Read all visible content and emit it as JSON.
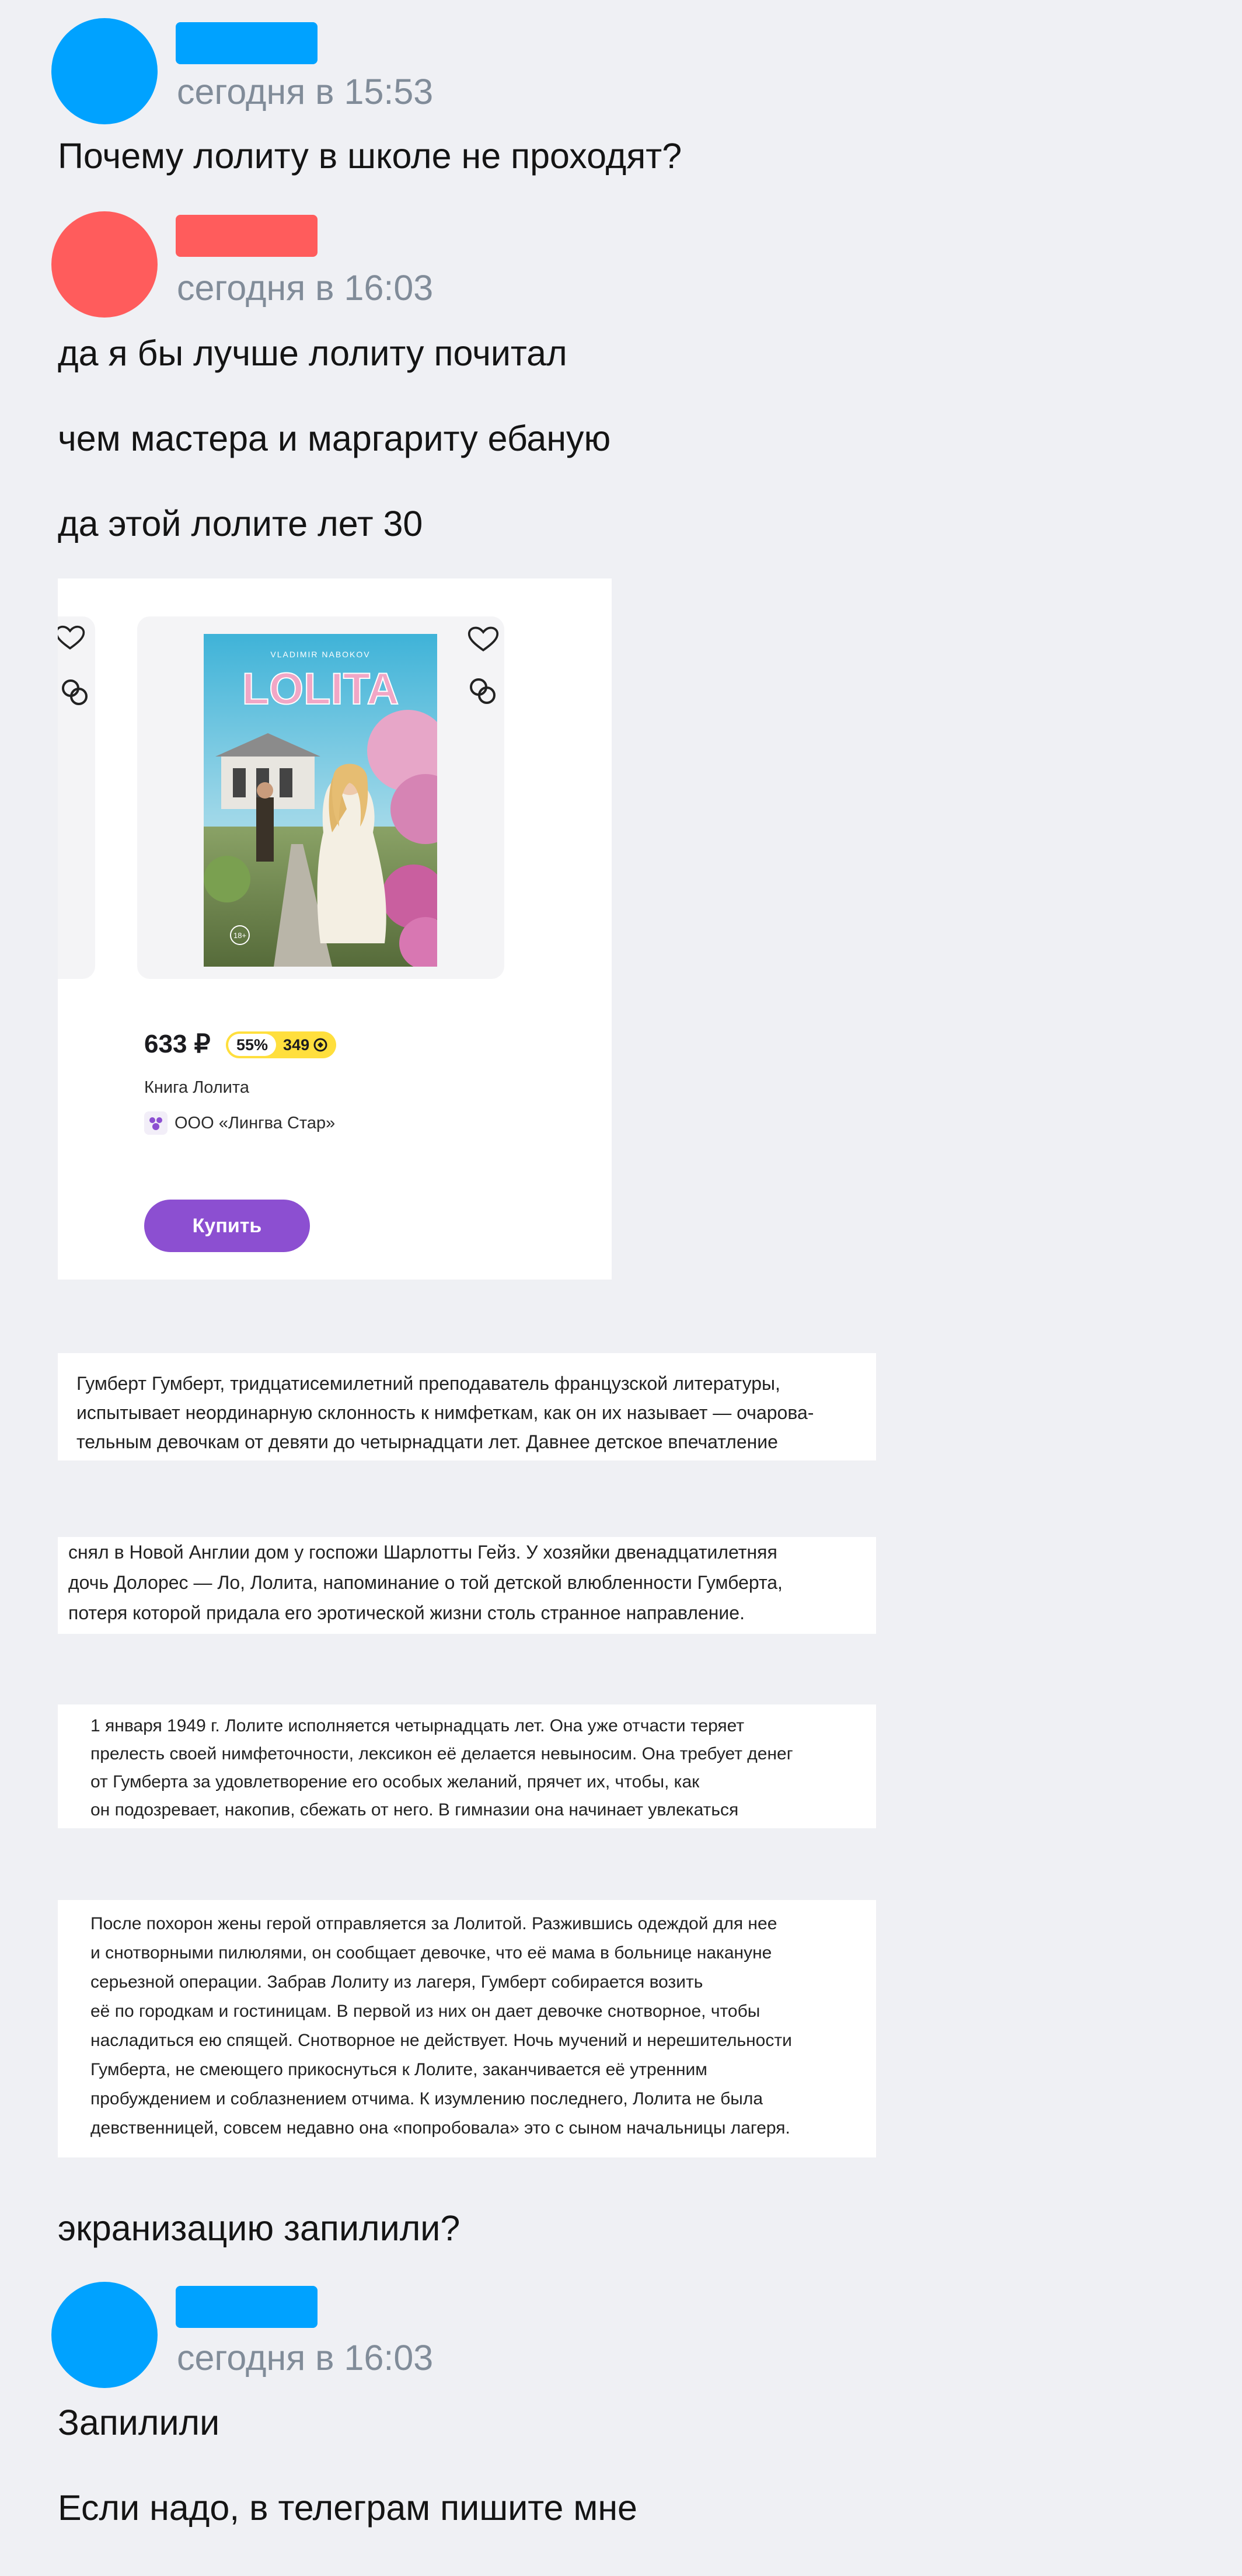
{
  "messages": [
    {
      "author_color": "#00a2ff",
      "time": "сегодня в 15:53",
      "lines": [
        "Почему лолиту в школе не проходят?"
      ]
    },
    {
      "author_color": "#ff5c5c",
      "time": "сегодня в 16:03",
      "lines": [
        "да я бы лучше лолиту почитал",
        "чем мастера и маргариту ебаную",
        "да этой лолите лет 30"
      ]
    },
    {
      "after_images": "экранизацию запилили?"
    },
    {
      "author_color": "#00a2ff",
      "time": "сегодня в 16:03",
      "lines": [
        "Запилили",
        "Если надо, в телеграм пишите мне"
      ]
    }
  ],
  "product_card": {
    "cover_author": "VLADIMIR NABOKOV",
    "cover_title": "LOLITA",
    "cover_age": "18+",
    "price": "633 ₽",
    "discount": "55%",
    "points": "349",
    "name": "Книга Лолита",
    "seller": "ООО «Лингва Стар»",
    "buy_label": "Купить",
    "icons": [
      "heart-icon",
      "compare-icon"
    ],
    "accent": "#8c4fd1",
    "badge_color": "#ffdf3d"
  },
  "excerpts": [
    [
      "Гумберт Гумберт, тридцатисемилетний преподаватель французской литературы,",
      "испытывает неординарную склонность к нимфеткам, как он их называет — очарова-",
      "тельным девочкам от девяти до четырнадцати лет. Давнее детское впечатление"
    ],
    [
      "снял в Новой Англии дом у госпожи Шарлотты Гейз. У хозяйки двенадцатилетняя",
      "дочь Долорес — Ло, Лолита, напоминание о той детской влюбленности Гумберта,",
      "потеря которой придала его эротической жизни столь странное направление."
    ],
    [
      "1 января 1949 г. Лолите исполняется четырнадцать лет. Она уже отчасти теряет",
      "прелесть своей нимфеточности, лексикон её делается невыносим. Она требует денег",
      "от Гумберта за удовлетворение его особых желаний, прячет их, чтобы, как",
      "он подозревает, накопив, сбежать от него. В гимназии она начинает увлекаться"
    ],
    [
      "После похорон жены герой отправляется за Лолитой. Разжившись одеждой для нее",
      "и снотворными пилюлями, он сообщает девочке, что её мама в больнице накануне",
      "серьезной операции. Забрав Лолиту из лагеря, Гумберт собирается возить",
      "её по городкам и гостиницам. В первой из них он дает девочке снотворное, чтобы",
      "насладиться ею спящей. Снотворное не действует. Ночь мучений и нерешительности",
      "Гумберта, не смеющего прикоснуться к Лолите, заканчивается её утренним",
      "пробуждением и соблазнением отчима. К изумлению последнего, Лолита не была",
      "девственницей, совсем недавно она «попробовала» это с сыном начальницы лагеря."
    ]
  ]
}
